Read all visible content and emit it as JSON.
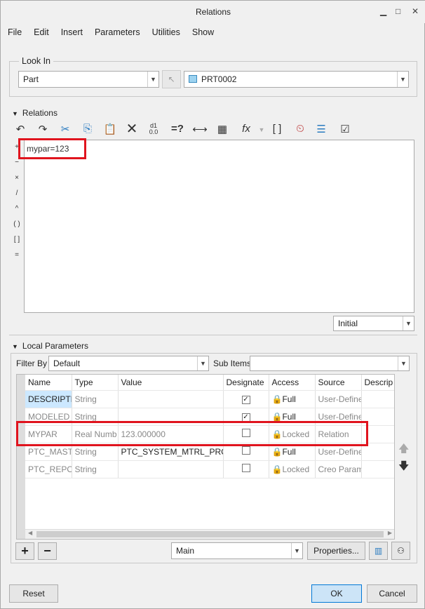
{
  "window": {
    "title": "Relations",
    "minimize": "▁",
    "maximize": "□",
    "close": "✕"
  },
  "menu": [
    "File",
    "Edit",
    "Insert",
    "Parameters",
    "Utilities",
    "Show"
  ],
  "look_in": {
    "label": "Look In",
    "type_value": "Part",
    "model_value": "PRT0002"
  },
  "relations": {
    "header": "Relations",
    "toolbar": [
      "undo",
      "redo",
      "cut",
      "copy",
      "paste",
      "delete",
      "evaluate",
      "=?",
      "⟼",
      "sort",
      "fx",
      "( )",
      "verify",
      "list",
      "check"
    ],
    "operators": [
      "+",
      "−",
      "×",
      "/",
      "^",
      "( )",
      "[ ]",
      "="
    ],
    "text": "mypar=123",
    "initial_label": "Initial"
  },
  "local_params": {
    "header": "Local Parameters",
    "filter_label": "Filter By",
    "filter_value": "Default",
    "sub_items_label": "Sub Items",
    "sub_items_value": "",
    "columns": [
      "Name",
      "Type",
      "Value",
      "Designate",
      "Access",
      "Source",
      "Descrip"
    ],
    "rows": [
      {
        "name": "DESCRIPTIO",
        "type": "String",
        "value": "",
        "designate": true,
        "access": "Full",
        "source": "User-Define"
      },
      {
        "name": "MODELED_",
        "type": "String",
        "value": "",
        "designate": true,
        "access": "Full",
        "source": "User-Define"
      },
      {
        "name": "MYPAR",
        "type": "Real Numb",
        "value": "123.000000",
        "designate": false,
        "access": "Locked",
        "source": "Relation"
      },
      {
        "name": "PTC_MASTE",
        "type": "String",
        "value": "PTC_SYSTEM_MTRL_PROPS",
        "designate": false,
        "access": "Full",
        "source": "User-Define"
      },
      {
        "name": "PTC_REPOR",
        "type": "String",
        "value": "",
        "designate": false,
        "access": "Locked",
        "source": "Creo Param"
      }
    ],
    "view_value": "Main",
    "properties_label": "Properties..."
  },
  "footer": {
    "reset": "Reset",
    "ok": "OK",
    "cancel": "Cancel"
  }
}
